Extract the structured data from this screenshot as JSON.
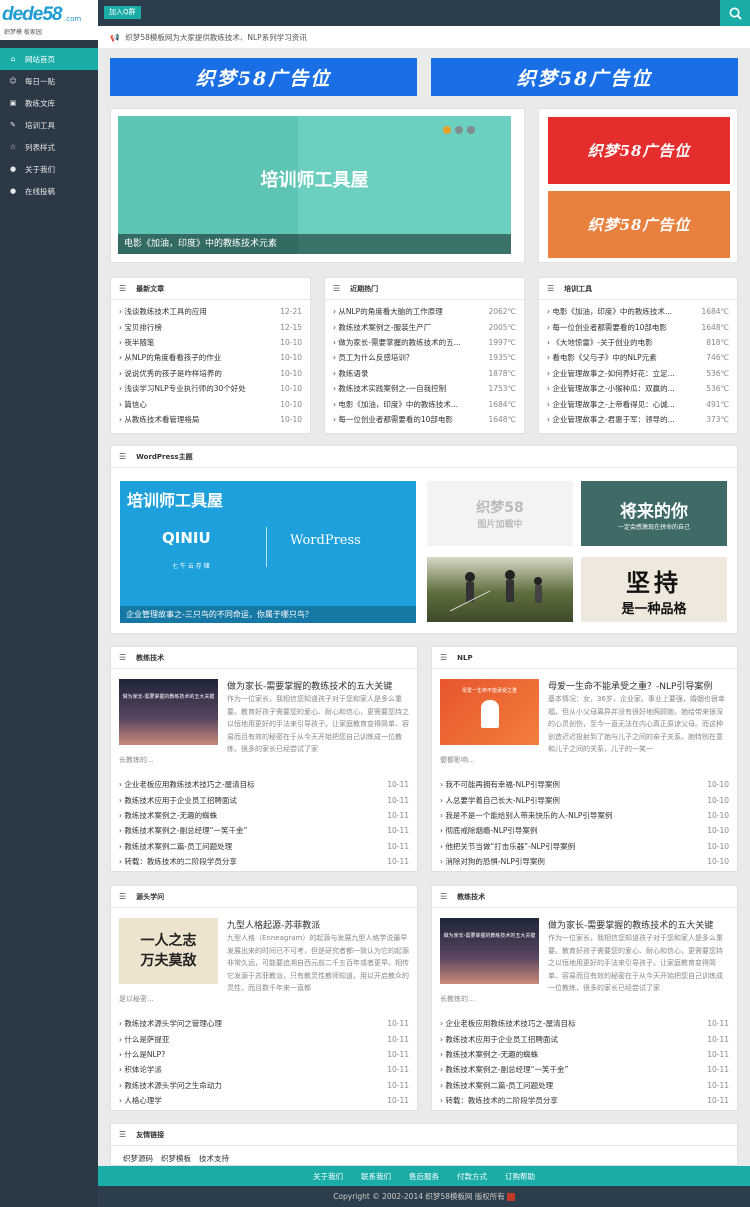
{
  "header": {
    "logo_main": "dede58",
    "logo_domain": ".com",
    "logo_sub": "织梦模 板家园",
    "qq_label": "加入Q群"
  },
  "sidebar": {
    "items": [
      {
        "label": "网站首页",
        "icon": "home-icon"
      },
      {
        "label": "每日一贴",
        "icon": "smile-icon"
      },
      {
        "label": "教练文库",
        "icon": "image-icon"
      },
      {
        "label": "培训工具",
        "icon": "pencil-icon"
      },
      {
        "label": "列表样式",
        "icon": "star-icon"
      },
      {
        "label": "关于我们",
        "icon": "chat-icon"
      },
      {
        "label": "在线投稿",
        "icon": "chat-icon"
      }
    ]
  },
  "notice": {
    "text": "织梦58模板网为大家提供教练技术、NLP系列学习资讯"
  },
  "ads": {
    "top_left": "织梦58广告位",
    "top_right": "织梦58广告位",
    "side1": "织梦58广告位",
    "side2": "织梦58广告位"
  },
  "slider": {
    "image_text": "培训师工具屋",
    "caption": "电影《加油，印度》中的教练技术元素"
  },
  "latest": {
    "title": "最新文章",
    "items": [
      {
        "t": "浅谈教练技术工具的应用",
        "d": "12-21"
      },
      {
        "t": "宝贝排行榜",
        "d": "12-15"
      },
      {
        "t": "夜半随笔",
        "d": "10-10"
      },
      {
        "t": "从NLP的角度看看孩子的作业",
        "d": "10-10"
      },
      {
        "t": "说说优秀的孩子是咋样培养的",
        "d": "10-10"
      },
      {
        "t": "浅谈学习NLP专业执行师的30个好处",
        "d": "10-10"
      },
      {
        "t": "篇信心",
        "d": "10-10"
      },
      {
        "t": "从教练技术看管理格局",
        "d": "10-10"
      }
    ]
  },
  "hot": {
    "title": "近期热门",
    "items": [
      {
        "t": "从NLP的角度看大脑的工作原理",
        "d": "2062℃"
      },
      {
        "t": "教练技术案例之-服装生产厂",
        "d": "2005℃"
      },
      {
        "t": "做为家长-需要掌握的教练技术的五...",
        "d": "1997℃"
      },
      {
        "t": "员工为什么反感培训？",
        "d": "1935℃"
      },
      {
        "t": "教练语录",
        "d": "1878℃"
      },
      {
        "t": "教练技术实践案例之-一自我控制",
        "d": "1753℃"
      },
      {
        "t": "电影《加油，印度》中的教练技术...",
        "d": "1684℃"
      },
      {
        "t": "每一位创业者都需要看的10部电影",
        "d": "1648℃"
      }
    ]
  },
  "tools": {
    "title": "培训工具",
    "items": [
      {
        "t": "电影《加油，印度》中的教练技术...",
        "d": "1684℃"
      },
      {
        "t": "每一位创业者都需要看的10部电影",
        "d": "1648℃"
      },
      {
        "t": "《大地惊雷》-关于创业的电影",
        "d": "818℃"
      },
      {
        "t": "看电影《父与子》中的NLP元素",
        "d": "746℃"
      },
      {
        "t": "企业管理故事之-如何养好花：立足...",
        "d": "536℃"
      },
      {
        "t": "企业管理故事之-小猴种瓜：双赢的...",
        "d": "536℃"
      },
      {
        "t": "企业管理故事之-上帝看得见：心诚...",
        "d": "491℃"
      },
      {
        "t": "企业管理故事之-君惠于军：领导的...",
        "d": "373℃"
      }
    ]
  },
  "wordpress": {
    "title": "WordPress主题",
    "big_title": "培训师工具屋",
    "qiniu": "QINIU",
    "qiniu_sub": "七 牛 云 存 储",
    "wp_logo": "WordPress",
    "big_caption": "企业管理故事之-三只鸟的不同命运，你属于哪只鸟？",
    "thumb1_a": "织梦58",
    "thumb1_b": "图片加载中",
    "thumb2_a": "将来的你",
    "thumb2_b": "一定会感激现在拼命的自己",
    "thumb4_a": "坚持",
    "thumb4_b": "是一种品格"
  },
  "section_coach": {
    "title": "教练技术",
    "art_title": "做为家长-需要掌握的教练技术的五大关键",
    "img_text": "做为家长-需要掌握的教练技术的五大关键",
    "desc": "作为一位家长，我相信您知道孩子对于您和家人是多么重要。教育好孩子需要您的爱心、耐心和信心，更需要您持之以恒地用更好的手法来引导孩子。让家庭教育变得简单、容易而且有效的秘密在于从今天开始把您自己训练成一位教练，很多的家长已经尝试了家",
    "desc2": "长教练的...",
    "items": [
      {
        "t": "企业老板应用教练技术技巧之-屋清目标",
        "d": "10-11"
      },
      {
        "t": "教练技术应用于企业员工招聘面试",
        "d": "10-11"
      },
      {
        "t": "教练技术案例之-无趣的蜘蛛",
        "d": "10-11"
      },
      {
        "t": "教练技术案例之-副总经理“一笑千金”",
        "d": "10-11"
      },
      {
        "t": "教练技术案例二篇-员工问题处理",
        "d": "10-11"
      },
      {
        "t": "转载：教练技术的二阶段学员分享",
        "d": "10-11"
      }
    ]
  },
  "section_nlp": {
    "title": "NLP",
    "art_title": "母爱一生命不能承受之重？-NLP引导案例",
    "img_text": "母爱一生命不能承受之重",
    "desc": "基本情况：女，36岁，企业家。事业上要强，婚姻也很幸福。但从小父母离异并没有很好地照顾她，她给带来很深的心灵创伤，至今一直无法在内心真正原谅父母。而这种创造迟迟投射到了她与儿子之间的亲子关系。她特别在意和儿子之间的关系，儿子的一笑一",
    "desc2": "颦都影响...",
    "items": [
      {
        "t": "我不可能再拥有幸福-NLP引导案例",
        "d": "10-10"
      },
      {
        "t": "人总要学着自己长大-NLP引导案例",
        "d": "10-10"
      },
      {
        "t": "我是不是一个能给别人带来快乐的人-NLP引导案例",
        "d": "10-10"
      },
      {
        "t": "彻底戒除烟瘾-NLP引导案例",
        "d": "10-10"
      },
      {
        "t": "他把关节当做“打击乐器”-NLP引导案例",
        "d": "10-10"
      },
      {
        "t": "消除对狗的恐惧-NLP引导案例",
        "d": "10-10"
      }
    ]
  },
  "section_source": {
    "title": "源头学问",
    "art_title": "九型人格起源-苏菲教派",
    "img_text_a": "一人之志",
    "img_text_b": "万夫莫敌",
    "desc": "九型人格（Enneagram）的起源与发展九型人格学说最早发展出来的时间已不可考，但是研究者都一致认为它的起源非常久远，可能要追溯自西元前二千五百年或者更早。相传它发源于苏菲教派，只有教灵性教师知道，用以开启教众的灵性，而且数千年来一直都",
    "desc2": "是以秘密...",
    "items": [
      {
        "t": "教练技术源头学问之管理心理",
        "d": "10-11"
      },
      {
        "t": "什么是萨提亚",
        "d": "10-11"
      },
      {
        "t": "什么是NLP?",
        "d": "10-11"
      },
      {
        "t": "积体论学派",
        "d": "10-11"
      },
      {
        "t": "教练技术源头学问之生命动力",
        "d": "10-11"
      },
      {
        "t": "人格心理学",
        "d": "10-11"
      }
    ]
  },
  "section_coach2": {
    "title": "教练技术",
    "art_title": "做为家长-需要掌握的教练技术的五大关键",
    "img_text": "做为家长-需要掌握的教练技术的五大关键",
    "desc": "作为一位家长，我相信您知道孩子对于您和家人是多么重要。教育好孩子需要您的爱心、耐心和信心，更需要您持之以恒地用更好的手法来引导孩子。让家庭教育变得简单、容易而且有效的秘密在于从今天开始把您自己训练成一位教练，很多的家长已经尝试了家",
    "desc2": "长教练的...",
    "items": [
      {
        "t": "企业老板应用教练技术技巧之-屋清目标",
        "d": "10-11"
      },
      {
        "t": "教练技术应用于企业员工招聘面试",
        "d": "10-11"
      },
      {
        "t": "教练技术案例之-无趣的蜘蛛",
        "d": "10-11"
      },
      {
        "t": "教练技术案例之-副总经理“一笑千金”",
        "d": "10-11"
      },
      {
        "t": "教练技术案例二篇-员工问题处理",
        "d": "10-11"
      },
      {
        "t": "转载：教练技术的二阶段学员分享",
        "d": "10-11"
      }
    ]
  },
  "friends": {
    "title": "友情链接",
    "items": [
      "织梦源码",
      "织梦模板",
      "技术支持"
    ]
  },
  "footer": {
    "links": [
      "关于我们",
      "联系我们",
      "售后服务",
      "付款方式",
      "订购帮助"
    ],
    "copyright": "Copyright © 2002-2014 织梦58模板网 版权所有"
  },
  "colors": {
    "accent": "#1aada7",
    "sidebar": "#2b3845",
    "ad_blue": "#1a6fe6",
    "ad_red": "#e62d2d",
    "ad_orange": "#e8803e"
  }
}
